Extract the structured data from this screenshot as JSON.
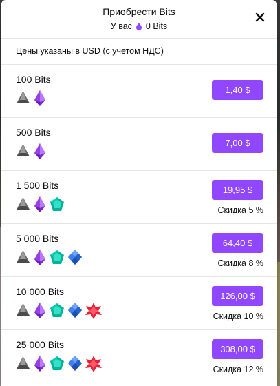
{
  "header": {
    "title": "Приобрести Bits",
    "balance_label": "У вас",
    "balance_value": "0 Bits",
    "close_icon": "close-icon"
  },
  "note": "Цены указаны в USD (с учетом НДС)",
  "colors": {
    "accent": "#9147ff",
    "gem_gray": "#7d7d7d",
    "gem_purple": "#9c3ee8",
    "gem_teal": "#00c7ac",
    "gem_blue": "#2e6fe2",
    "gem_red": "#e81f35"
  },
  "offers": [
    {
      "amount": "100 Bits",
      "price": "1,40 $",
      "discount": "",
      "gems": [
        "gray-bit-icon",
        "purple-bit-icon"
      ]
    },
    {
      "amount": "500 Bits",
      "price": "7,00 $",
      "discount": "",
      "gems": [
        "gray-bit-icon",
        "purple-bit-icon"
      ]
    },
    {
      "amount": "1 500 Bits",
      "price": "19,95 $",
      "discount": "Скидка 5 %",
      "gems": [
        "gray-bit-icon",
        "purple-bit-icon",
        "teal-bit-icon"
      ]
    },
    {
      "amount": "5 000 Bits",
      "price": "64,40 $",
      "discount": "Скидка 8 %",
      "gems": [
        "gray-bit-icon",
        "purple-bit-icon",
        "teal-bit-icon",
        "blue-bit-icon"
      ]
    },
    {
      "amount": "10 000 Bits",
      "price": "126,00 $",
      "discount": "Скидка 10 %",
      "gems": [
        "gray-bit-icon",
        "purple-bit-icon",
        "teal-bit-icon",
        "blue-bit-icon",
        "red-bit-icon"
      ]
    },
    {
      "amount": "25 000 Bits",
      "price": "308,00 $",
      "discount": "Скидка 12 %",
      "gems": [
        "gray-bit-icon",
        "purple-bit-icon",
        "teal-bit-icon",
        "blue-bit-icon",
        "red-bit-icon"
      ]
    }
  ]
}
